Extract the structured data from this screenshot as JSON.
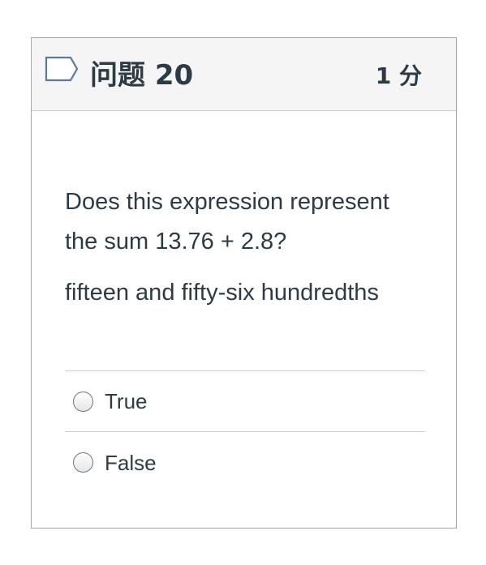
{
  "question": {
    "title": "问题 20",
    "points": "1 分",
    "text": "Does this expression represent the sum 13.76 + 2.8?",
    "subtext": "fifteen and fifty-six hundredths",
    "answers": [
      {
        "label": "True",
        "selected": false
      },
      {
        "label": "False",
        "selected": false
      }
    ]
  },
  "icons": {
    "flag": "flag-outline-icon"
  },
  "colors": {
    "text": "#2d3b45",
    "header_bg": "#f5f5f5",
    "border": "#a5a5a5",
    "flag_stroke": "#5b7a99"
  }
}
